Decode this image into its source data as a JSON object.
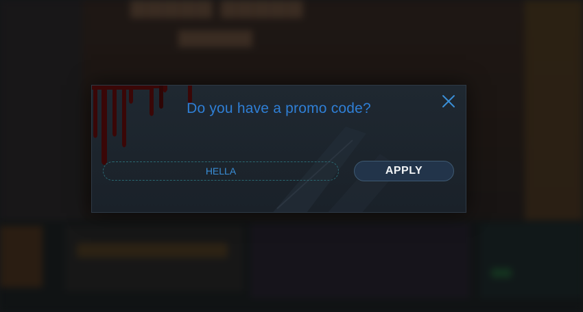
{
  "modal": {
    "title": "Do you have a promo code?",
    "close_icon": "close-icon",
    "promo_input": {
      "value": "HELLA",
      "placeholder": ""
    },
    "apply_label": "APPLY"
  },
  "colors": {
    "title": "#2f7fd6",
    "input_text": "#3a8fd8",
    "input_border": "#2a6a74",
    "apply_bg": "#22344a",
    "apply_border": "#3f5a72",
    "modal_bg": "#1d252d",
    "blood": "#3a0707"
  }
}
